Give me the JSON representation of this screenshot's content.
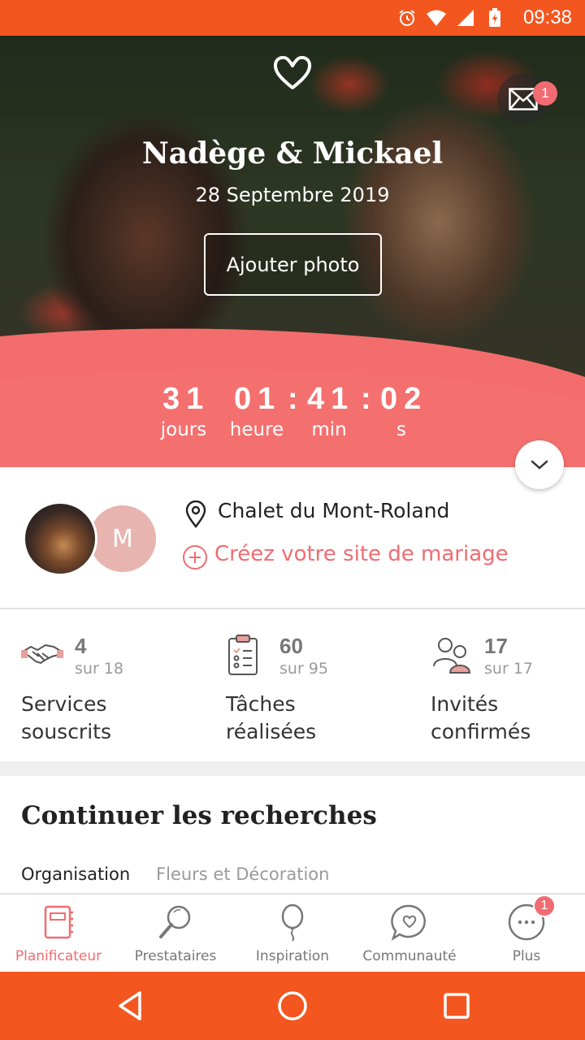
{
  "status_bar": {
    "time": "09:38"
  },
  "hero": {
    "names": "Nadège & Mickael",
    "date": "28 Septembre 2019",
    "add_photo_label": "Ajouter photo",
    "mail_badge": "1"
  },
  "countdown": {
    "days": "31",
    "hours": "01",
    "minutes": "41",
    "seconds": "02",
    "days_unit": "jours",
    "hours_unit": "heure",
    "minutes_unit": "min",
    "seconds_unit": "s"
  },
  "profile": {
    "avatar_initial": "M",
    "venue": "Chalet du Mont-Roland",
    "create_site_label": "Créez votre site de mariage"
  },
  "stats": [
    {
      "count": "4",
      "total": "sur 18",
      "label": "Services souscrits",
      "icon": "handshake-icon"
    },
    {
      "count": "60",
      "total": "sur 95",
      "label": "Tâches réalisées",
      "icon": "clipboard-checklist-icon"
    },
    {
      "count": "17",
      "total": "sur 17",
      "label": "Invités confirmés",
      "icon": "guests-icon"
    }
  ],
  "searches": {
    "title": "Continuer les recherches",
    "tabs": [
      "Organisation",
      "Fleurs et Décoration"
    ]
  },
  "bottom_nav": {
    "items": [
      {
        "label": "Planificateur",
        "icon": "planner-book-icon"
      },
      {
        "label": "Prestataires",
        "icon": "search-icon"
      },
      {
        "label": "Inspiration",
        "icon": "balloon-icon"
      },
      {
        "label": "Communauté",
        "icon": "chat-heart-icon"
      },
      {
        "label": "Plus",
        "icon": "more-icon"
      }
    ],
    "more_badge": "1"
  },
  "colors": {
    "accent": "#f06c72",
    "status_bar": "#f4561f",
    "muted": "#9a9a9a"
  }
}
